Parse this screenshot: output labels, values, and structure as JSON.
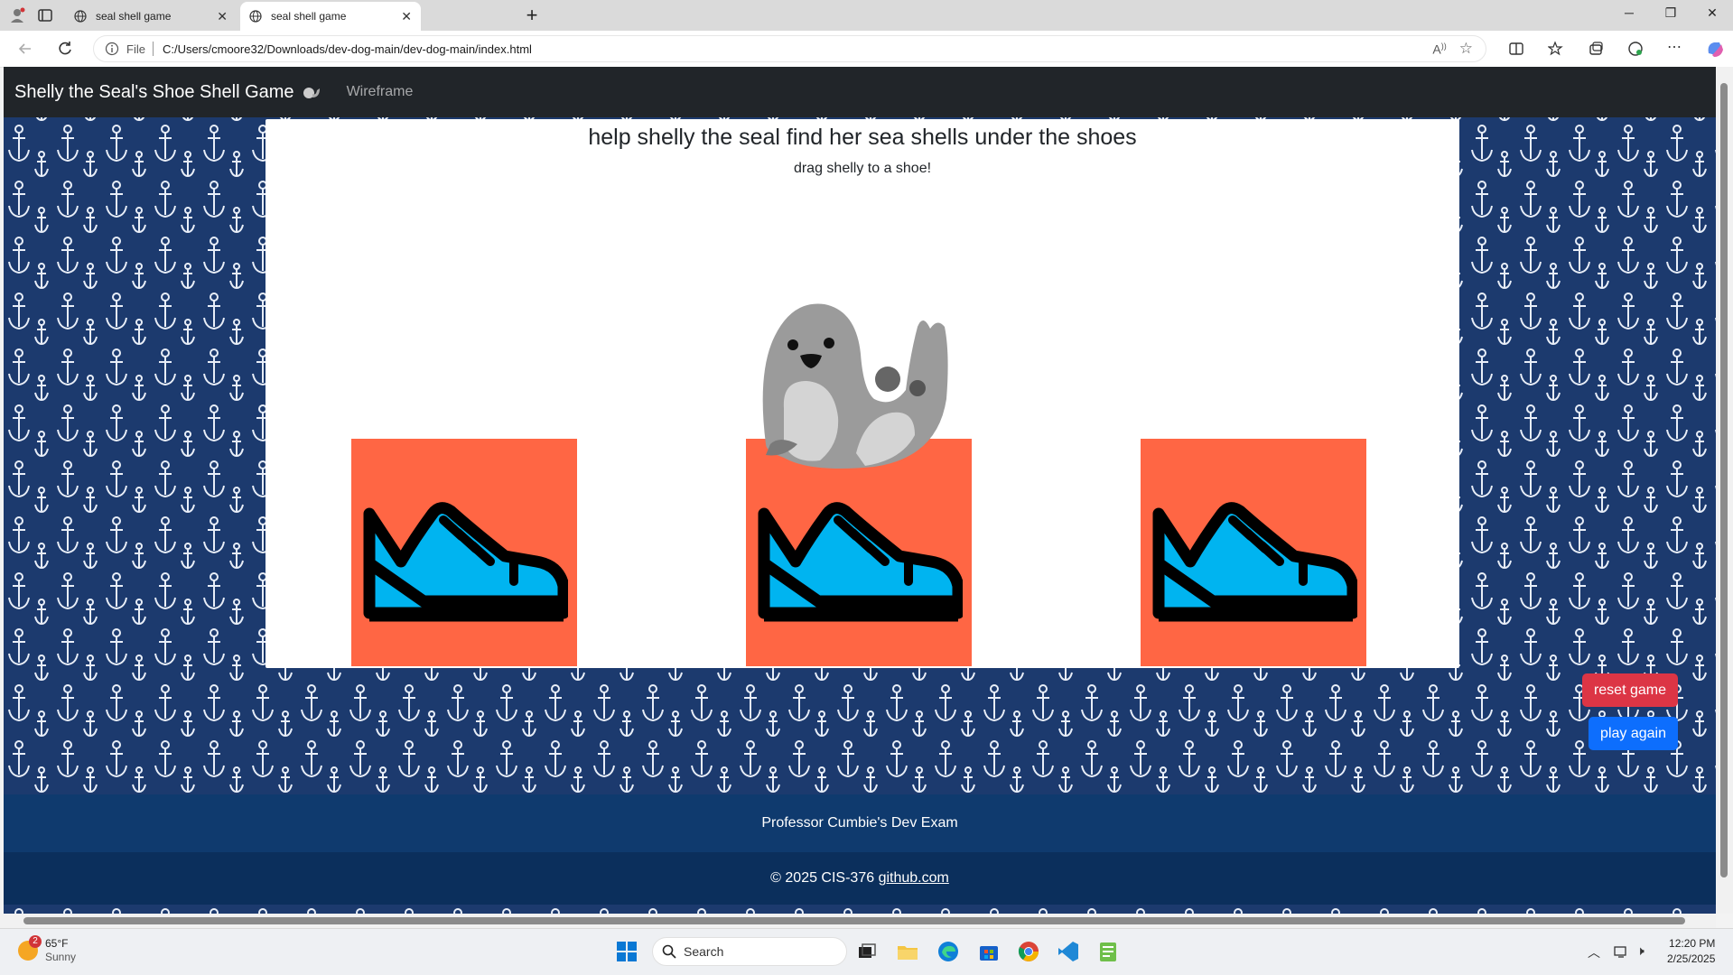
{
  "browser": {
    "tabs": [
      {
        "title": "seal shell game",
        "active": false
      },
      {
        "title": "seal shell game",
        "active": true
      }
    ],
    "address": {
      "scheme_label": "File",
      "url": "C:/Users/cmoore32/Downloads/dev-dog-main/dev-dog-main/index.html"
    }
  },
  "navbar": {
    "brand": "Shelly the Seal's Shoe Shell Game",
    "link": "Wireframe"
  },
  "game": {
    "heading": "help shelly the seal find her sea shells under the shoes",
    "instruction": "drag shelly to a shoe!",
    "shoe_color": "#ff6644",
    "shoe_count": 3
  },
  "buttons": {
    "reset": "reset game",
    "play_again": "play again"
  },
  "footer": {
    "line1": "Professor Cumbie's Dev Exam",
    "copyright": "© 2025 CIS-376",
    "link": "github.com"
  },
  "taskbar": {
    "weather_temp": "65°F",
    "weather_desc": "Sunny",
    "weather_badge": "2",
    "search_placeholder": "Search",
    "time": "12:20 PM",
    "date": "2/25/2025"
  }
}
